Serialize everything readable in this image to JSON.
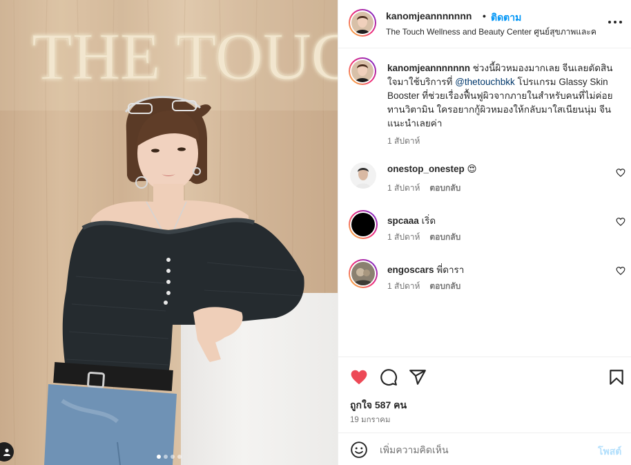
{
  "post": {
    "username": "kanomjeannnnnnn",
    "separator": "•",
    "follow_label": "ติดตาม",
    "location": "The Touch Wellness and Beauty Center ศูนย์สุขภาพและค",
    "more_icon": "more-horizontal-icon"
  },
  "photo": {
    "sign_text": "THE TOUC",
    "carousel_total": 4,
    "carousel_active": 1
  },
  "caption": {
    "username": "kanomjeannnnnnn",
    "text_before_mention": " ช่วงนี้ผิวหมองมากเลย จีนเลยตัดสินใจมาใช้บริการที่ ",
    "mention": "@thetouchbkk",
    "text_after_mention": " โปรแกรม Glassy Skin Booster ที่ช่วยเรื่องฟื้นฟูผิวจากภายในสำหรับคนที่ไม่ค่อยทานวิตามิน ใครอยากกู้ผิวหมองให้กลับมาใสเนียนนุ่ม จีนแนะนำเลยค่า",
    "time": "1 สัปดาห์"
  },
  "comments": [
    {
      "username": "onestop_onestep",
      "text": "😍",
      "time": "1 สัปดาห์",
      "reply_label": "ตอบกลับ"
    },
    {
      "username": "spcaaa",
      "text": "เริ่ด",
      "time": "1 สัปดาห์",
      "reply_label": "ตอบกลับ"
    },
    {
      "username": "engoscars",
      "text": "พี่ดารา",
      "time": "1 สัปดาห์",
      "reply_label": "ตอบกลับ"
    }
  ],
  "actions": {
    "liked": true,
    "like_color": "#ed4956",
    "likes_text": "ถูกใจ 587 คน",
    "date": "19 มกราคม"
  },
  "comment_box": {
    "placeholder": "เพิ่มความคิดเห็น",
    "post_label": "โพสต์"
  },
  "colors": {
    "accent_blue": "#0095f6",
    "mention_blue": "#00376b",
    "post_disabled": "#b2dffc"
  }
}
